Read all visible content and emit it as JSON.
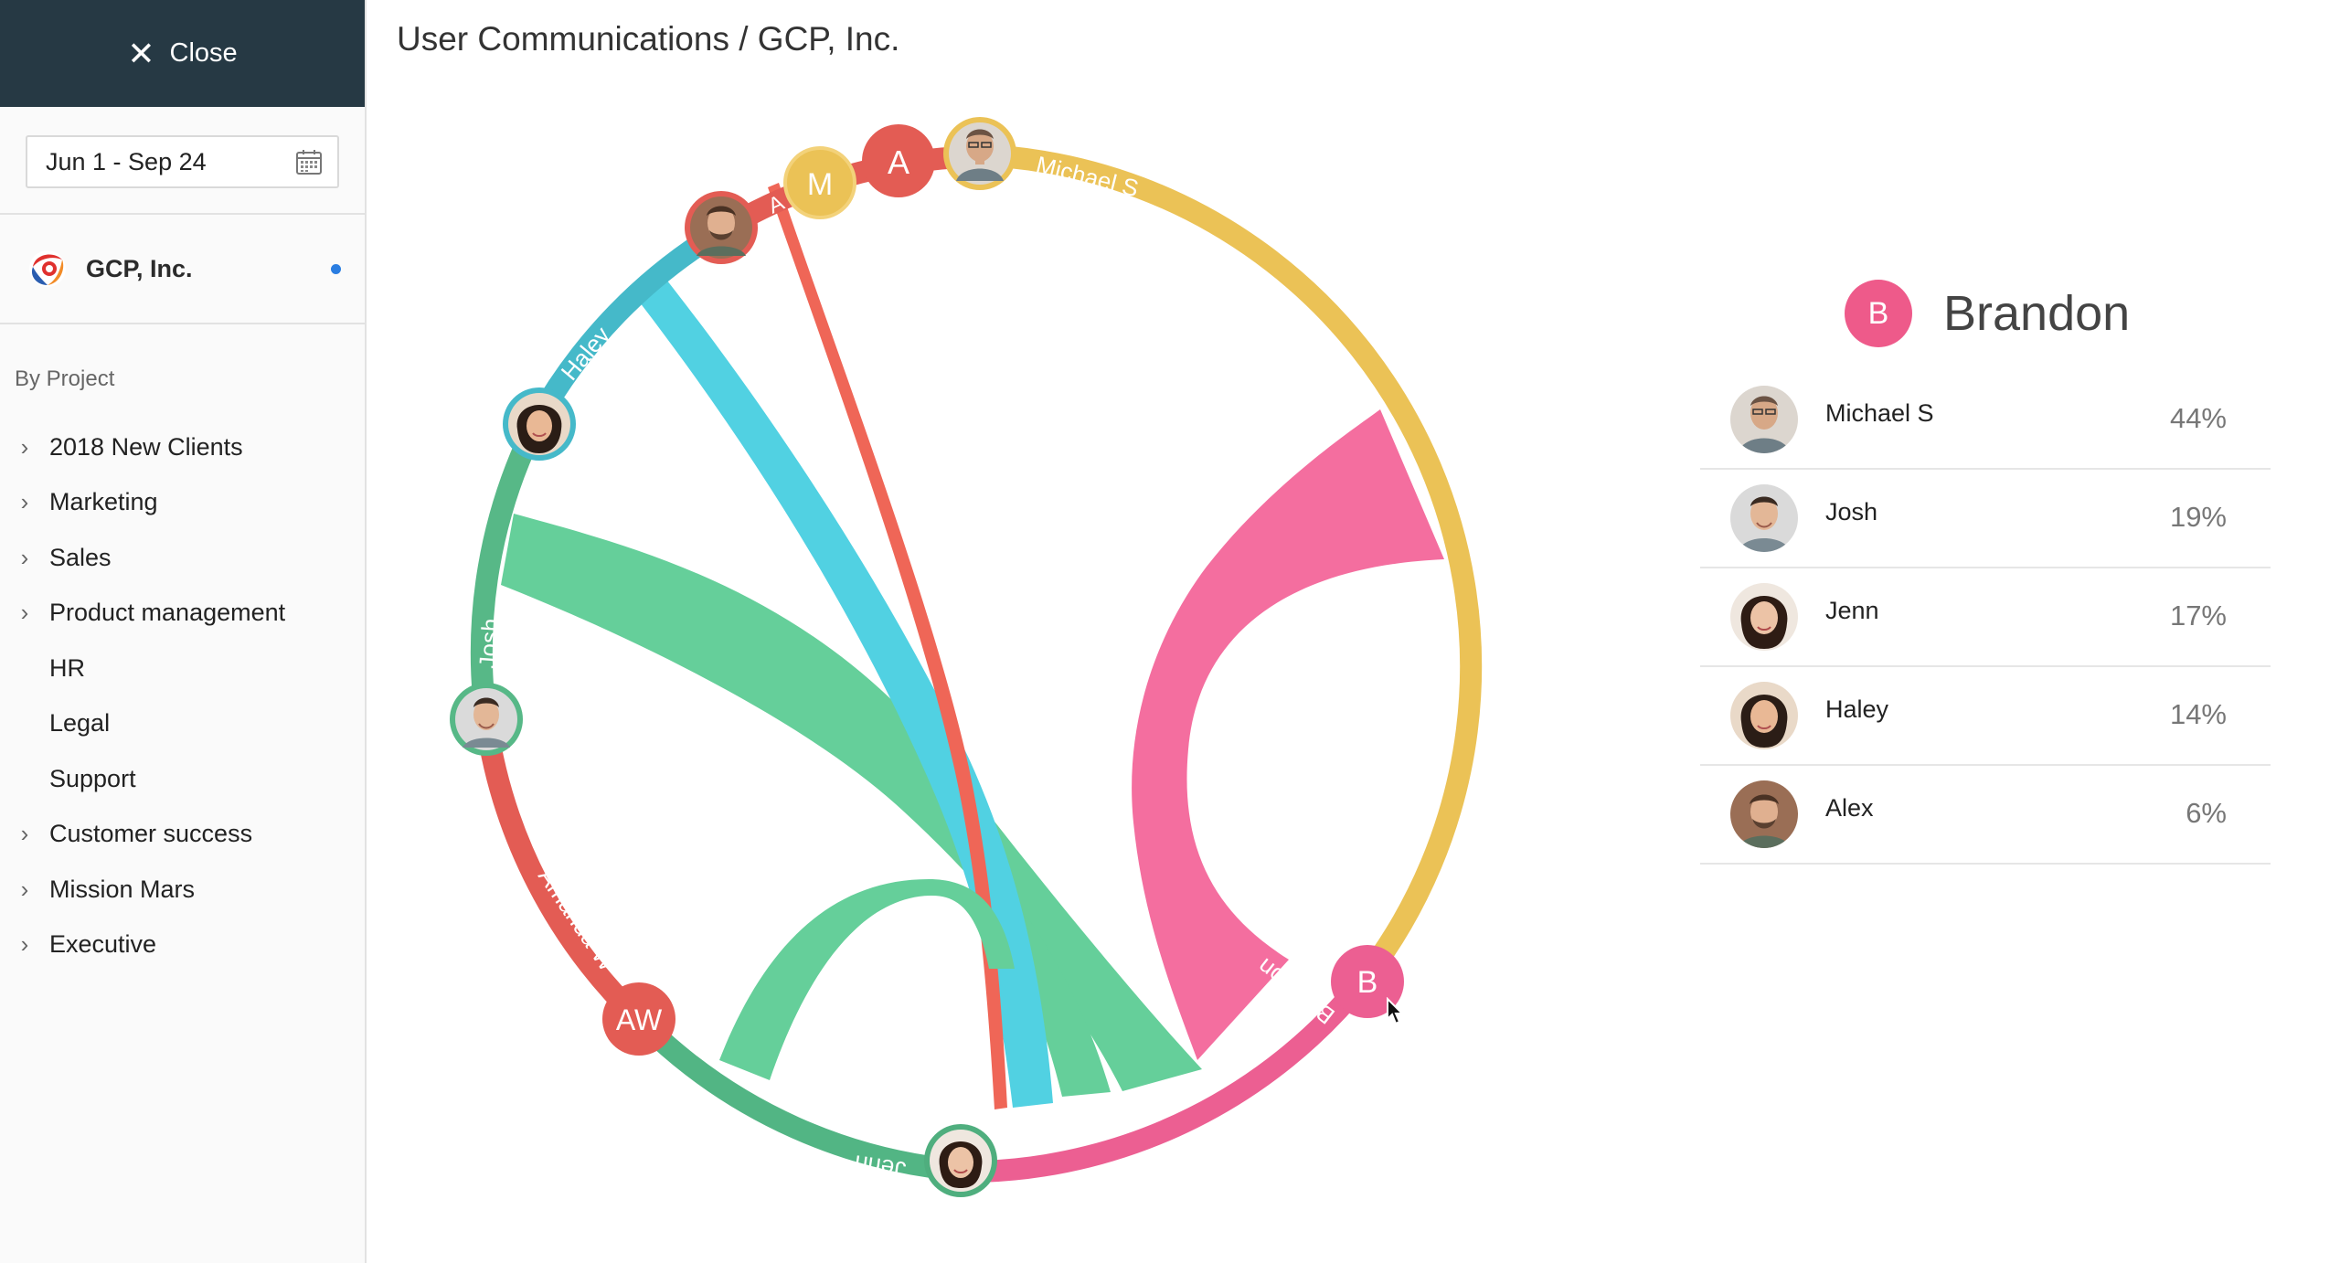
{
  "sidebar": {
    "close_label": "Close",
    "date_range": "Jun 1 - Sep 24",
    "company": "GCP, Inc.",
    "section_label": "By Project",
    "projects": [
      {
        "label": "2018 New Clients",
        "expandable": true
      },
      {
        "label": "Marketing",
        "expandable": true
      },
      {
        "label": "Sales",
        "expandable": true
      },
      {
        "label": "Product management",
        "expandable": true
      },
      {
        "label": "HR",
        "expandable": false
      },
      {
        "label": "Legal",
        "expandable": false
      },
      {
        "label": "Support",
        "expandable": false
      },
      {
        "label": "Customer success",
        "expandable": true
      },
      {
        "label": "Mission Mars",
        "expandable": true
      },
      {
        "label": "Executive",
        "expandable": true
      }
    ]
  },
  "page": {
    "title": "User Communications / GCP, Inc."
  },
  "colors": {
    "sidebar_header": "#263944",
    "yellow": "#ebc256",
    "pink": "#f06a9c",
    "red": "#e35c54",
    "cyan": "#4fcde0",
    "green": "#5dc08f",
    "teal": "#48b7c6",
    "green_dark": "#4fae7e"
  },
  "chord": {
    "users": [
      {
        "id": "michael",
        "label": "Michael S",
        "color": "#ebc256",
        "avatar": "photo"
      },
      {
        "id": "brandon",
        "label": "Brandon",
        "color": "#f06a9c",
        "avatar": "B"
      },
      {
        "id": "jenn",
        "label": "Jenn",
        "color": "#4fae7e",
        "avatar": "photo"
      },
      {
        "id": "amanda",
        "label": "Amanda W",
        "color": "#e35c54",
        "avatar": "AW"
      },
      {
        "id": "josh",
        "label": "Josh",
        "color": "#5dc08f",
        "avatar": "photo"
      },
      {
        "id": "haley",
        "label": "Haley",
        "color": "#48b7c6",
        "avatar": "photo"
      },
      {
        "id": "alex",
        "label": "A",
        "color": "#e35c54",
        "avatar": "photo"
      },
      {
        "id": "m",
        "label": "",
        "color": "#ebc256",
        "avatar": "M"
      },
      {
        "id": "a",
        "label": "",
        "color": "#e35c54",
        "avatar": "A"
      }
    ]
  },
  "detail": {
    "initial": "B",
    "name": "Brandon",
    "contacts": [
      {
        "name": "Michael S",
        "percent": "44%"
      },
      {
        "name": "Josh",
        "percent": "19%"
      },
      {
        "name": "Jenn",
        "percent": "17%"
      },
      {
        "name": "Haley",
        "percent": "14%"
      },
      {
        "name": "Alex",
        "percent": "6%"
      }
    ]
  }
}
